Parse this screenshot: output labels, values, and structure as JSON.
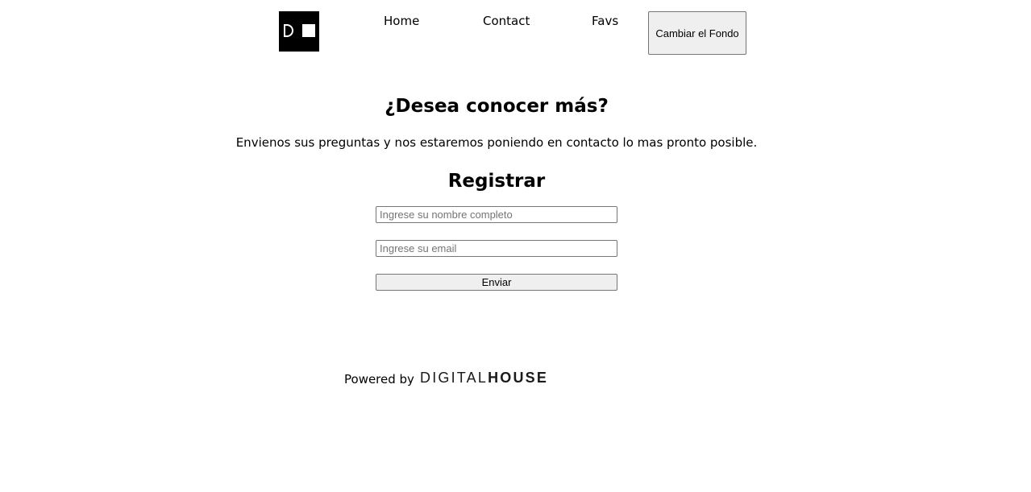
{
  "header": {
    "logo_name": "digital-house-logo",
    "nav": {
      "home": "Home",
      "contact": "Contact",
      "favs": "Favs"
    },
    "background_button_label": "Cambiar el Fondo"
  },
  "main": {
    "hero_title": "¿Desea conocer más?",
    "hero_text": "Envienos sus preguntas y nos estaremos poniendo en contacto lo mas pronto posible.",
    "register_title": "Registrar",
    "form": {
      "name_value": "",
      "name_placeholder": "Ingrese su nombre completo",
      "email_value": "",
      "email_placeholder": "Ingrese su email",
      "submit_label": "Enviar"
    }
  },
  "footer": {
    "powered_by": "Powered by",
    "brand_light": "DIGITAL",
    "brand_heavy": "HOUSE"
  },
  "colors": {
    "page_background": "#ffffff",
    "logo_background": "#000000",
    "button_background": "#efefef",
    "border": "#767676"
  }
}
